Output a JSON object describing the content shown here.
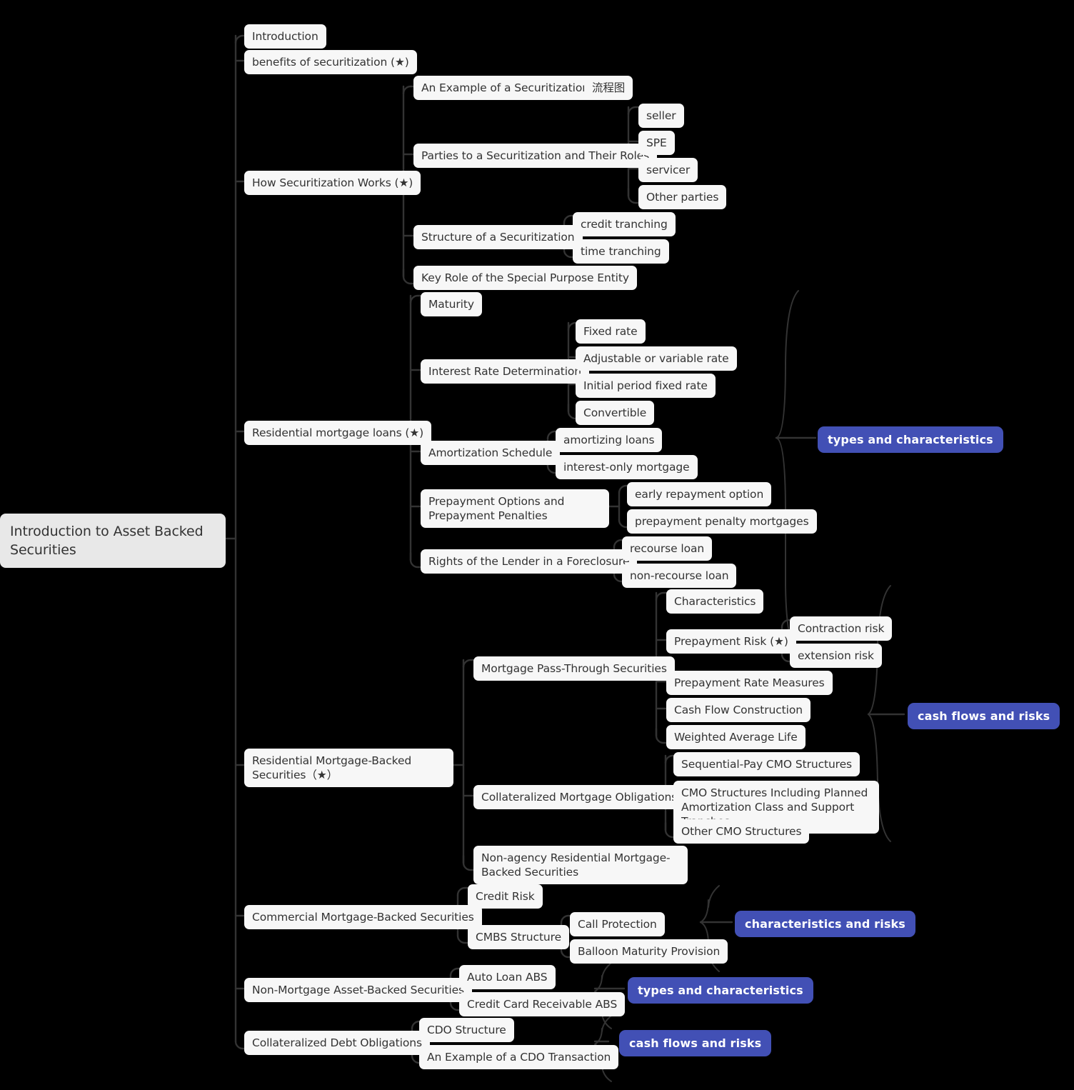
{
  "mindmap": {
    "root": {
      "label": "Introduction to Asset Backed Securities"
    },
    "nodes": {
      "introduction": "Introduction",
      "benefits": "benefits of securitization (★)",
      "how_securitization_works": "How Securitization Works (★)",
      "an_example_of_a_securitization": "An Example of a Securitization",
      "liuchengtu": "流程图",
      "parties_roles": "Parties to a Securitization and Their Roles",
      "seller": "seller",
      "spe": "SPE",
      "servicer": "servicer",
      "other_parties": "Other parties",
      "structure_of_a_securitization": "Structure of a Securitization",
      "credit_tranching": "credit tranching",
      "time_tranching": "time tranching",
      "key_role_spe": "Key Role of the Special Purpose Entity",
      "residential_mortgage_loans": "Residential mortgage loans (★)",
      "maturity": "Maturity",
      "interest_rate_determination": "Interest Rate Determination",
      "fixed_rate": "Fixed rate",
      "adjustable_rate": "Adjustable or variable rate",
      "initial_period_fixed_rate": "Initial period fixed rate",
      "convertible": "Convertible",
      "amortization_schedule": "Amortization Schedule",
      "amortizing_loans": "amortizing loans",
      "interest_only_mortgage": "interest-only mortgage",
      "prepayment_options": "Prepayment Options and Prepayment Penalties",
      "early_repayment_option": "early repayment option",
      "prepayment_penalty_mortgages": "prepayment penalty mortgages",
      "rights_of_lender": "Rights of the Lender in a Foreclosure",
      "recourse_loan": "recourse loan",
      "non_recourse_loan": "non-recourse loan",
      "rmbs": "Residential Mortgage-Backed Securities（★）",
      "mortgage_pass_through": "Mortgage Pass-Through Securities",
      "characteristics": "Characteristics",
      "prepayment_risk": "Prepayment Risk (★)",
      "contraction_risk": "Contraction risk",
      "extension_risk": "extension risk",
      "prepayment_rate_measures": "Prepayment Rate Measures",
      "cash_flow_construction": "Cash Flow Construction",
      "weighted_average_life": "Weighted Average Life",
      "cmo": "Collateralized Mortgage Obligations",
      "sequential_pay_cmo": "Sequential-Pay CMO Structures",
      "cmo_pac": "CMO Structures Including Planned Amortization Class and Support Tranches",
      "other_cmo": "Other CMO Structures",
      "non_agency_rmbs": "Non-agency Residential Mortgage-Backed Securities",
      "cmbs": "Commercial Mortgage-Backed Securities",
      "credit_risk": "Credit Risk",
      "cmbs_structure": "CMBS Structure",
      "call_protection": "Call Protection",
      "balloon_maturity_provision": "Balloon Maturity Provision",
      "non_mortgage_abs": "Non-Mortgage Asset-Backed Securities",
      "auto_loan_abs": "Auto Loan ABS",
      "credit_card_abs": "Credit Card Receivable ABS",
      "cdo": "Collateralized Debt Obligations",
      "cdo_structure": "CDO Structure",
      "cdo_example": "An Example of a CDO Transaction"
    },
    "summaries": {
      "types_and_characteristics_rml": "types and characteristics",
      "cash_flows_and_risks_rmbs": "cash flows and risks",
      "characteristics_and_risks_cmbs": "characteristics and risks",
      "types_and_characteristics_abs": "types and characteristics",
      "cash_flows_and_risks_cdo": "cash flows and risks"
    },
    "colors": {
      "node_bg": "#f7f7f7",
      "root_bg": "#e8e8e8",
      "text": "#333333",
      "badge_bg": "#4250b5",
      "badge_text": "#ffffff",
      "link": "#333333",
      "canvas_bg": "#000000"
    }
  }
}
